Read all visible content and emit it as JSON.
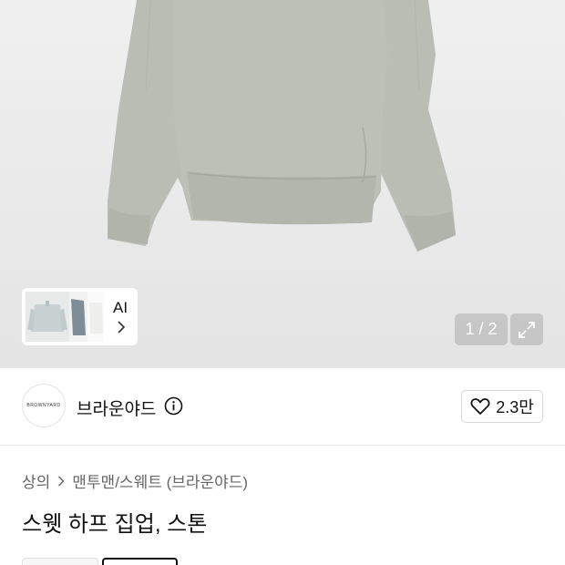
{
  "gallery": {
    "thumb_label": "AI",
    "pager": "1 / 2"
  },
  "brand": {
    "logo_text": "BROWNYARD",
    "name": "브라운야드",
    "like_count": "2.3만"
  },
  "breadcrumb": {
    "category": "상의",
    "subcategory": "맨투맨/스웨트 (브라운야드)"
  },
  "product": {
    "title": "스웻 하프 집업, 스톤"
  },
  "colors": {
    "garment": "#b9bdb4",
    "garment_shadow": "#a7ab9f"
  }
}
